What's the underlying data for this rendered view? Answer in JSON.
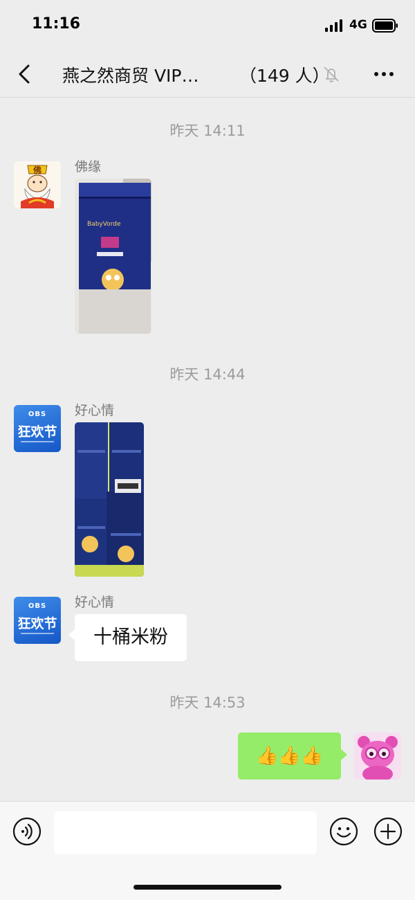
{
  "status_bar": {
    "time": "11:16",
    "network": "4G"
  },
  "nav": {
    "title": "燕之然商贸 VIP…",
    "member_count": "（149 人）"
  },
  "messages": [
    {
      "timestamp": "昨天 14:11",
      "sender": "佛缘",
      "type": "image",
      "avatar_char": "佛"
    },
    {
      "timestamp": "昨天 14:44",
      "sender": "好心情",
      "type": "image",
      "avatar_top": "OBS",
      "avatar_text": "狂欢节"
    },
    {
      "sender": "好心情",
      "type": "text",
      "text": "十桶米粉",
      "avatar_top": "OBS",
      "avatar_text": "狂欢节"
    },
    {
      "timestamp": "昨天 14:53",
      "type": "emoji",
      "text": "👍👍👍",
      "outgoing": true
    }
  ],
  "input": {
    "placeholder": ""
  },
  "colors": {
    "background": "#ededed",
    "bubble_self": "#95ec69",
    "bubble_other": "#ffffff",
    "timestamp": "#9b9b9b"
  },
  "icons": [
    "back-icon",
    "mute-icon",
    "more-icon",
    "voice-icon",
    "emoji-icon",
    "plus-icon",
    "signal-icon",
    "battery-icon"
  ]
}
